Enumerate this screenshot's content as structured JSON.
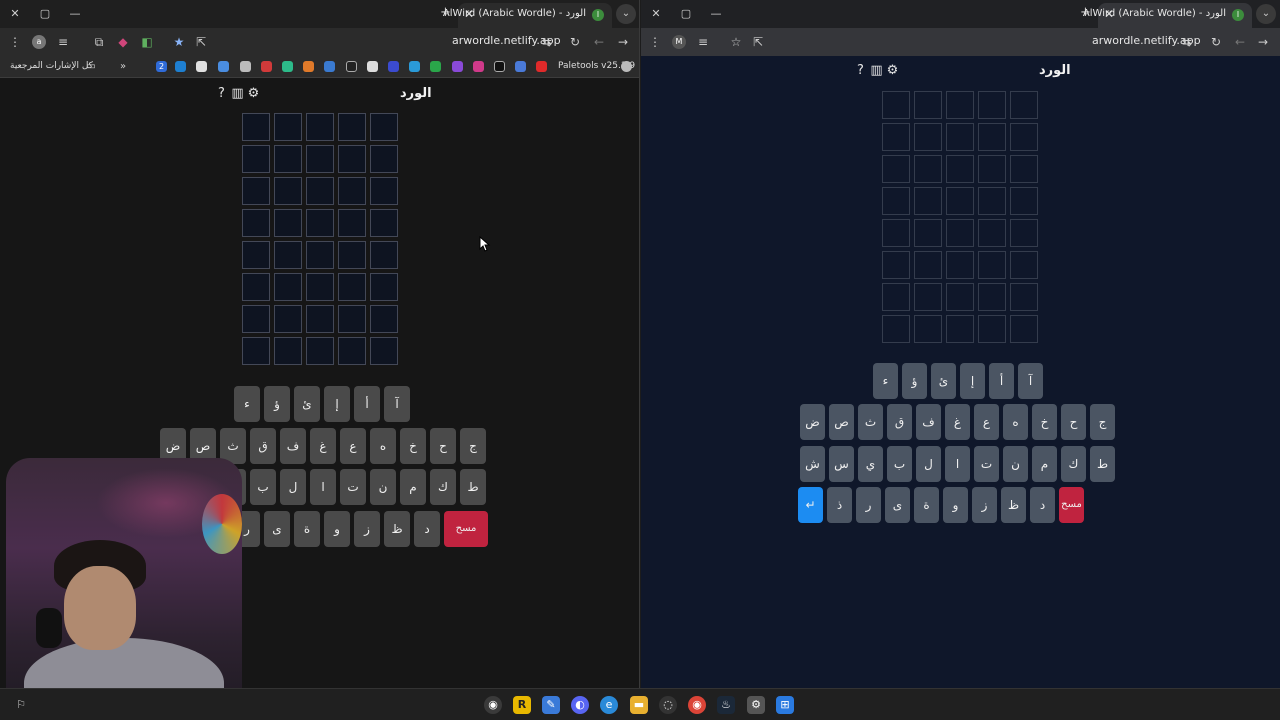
{
  "left": {
    "tab_title": "AlWird (Arabic Wordle) - الورد",
    "url": "arwordle.netlify.app",
    "avatar_letter": "a",
    "bookmarks_label": "كل الإشارات المرجعية",
    "paletools": "Paletools v25.1.9",
    "extension_badge": "2"
  },
  "right": {
    "tab_title": "AlWird (Arabic Wordle) - الورد",
    "url": "arwordle.netlify.app",
    "avatar_letter": "M"
  },
  "app": {
    "title": "الورد",
    "help_icon": "?",
    "stats_icon": "▥",
    "settings_icon": "⚙",
    "rows": 8,
    "cols": 5,
    "delete_label": "مسح",
    "enter_label": "↵"
  },
  "keyboard": {
    "row1": [
      "آ",
      "أ",
      "إ",
      "ئ",
      "ؤ",
      "ء"
    ],
    "row2": [
      "ج",
      "ح",
      "خ",
      "ه",
      "ع",
      "غ",
      "ف",
      "ق",
      "ث",
      "ص",
      "ض"
    ],
    "row3": [
      "ط",
      "ك",
      "م",
      "ن",
      "ت",
      "ا",
      "ل",
      "ب",
      "ي",
      "س",
      "ش"
    ],
    "row4": [
      "د",
      "ظ",
      "ز",
      "و",
      "ة",
      "ى",
      "ر",
      "ذ"
    ],
    "row4_left_visible": [
      "د",
      "ظ",
      "ز",
      "و",
      "ة",
      "ى",
      "ر"
    ]
  },
  "colors": {
    "delete": "#c0233f",
    "enter": "#1c8cf2",
    "key_left": "#4a4a4a",
    "key_right": "#4b5563",
    "bg_right": "#0f172a"
  }
}
